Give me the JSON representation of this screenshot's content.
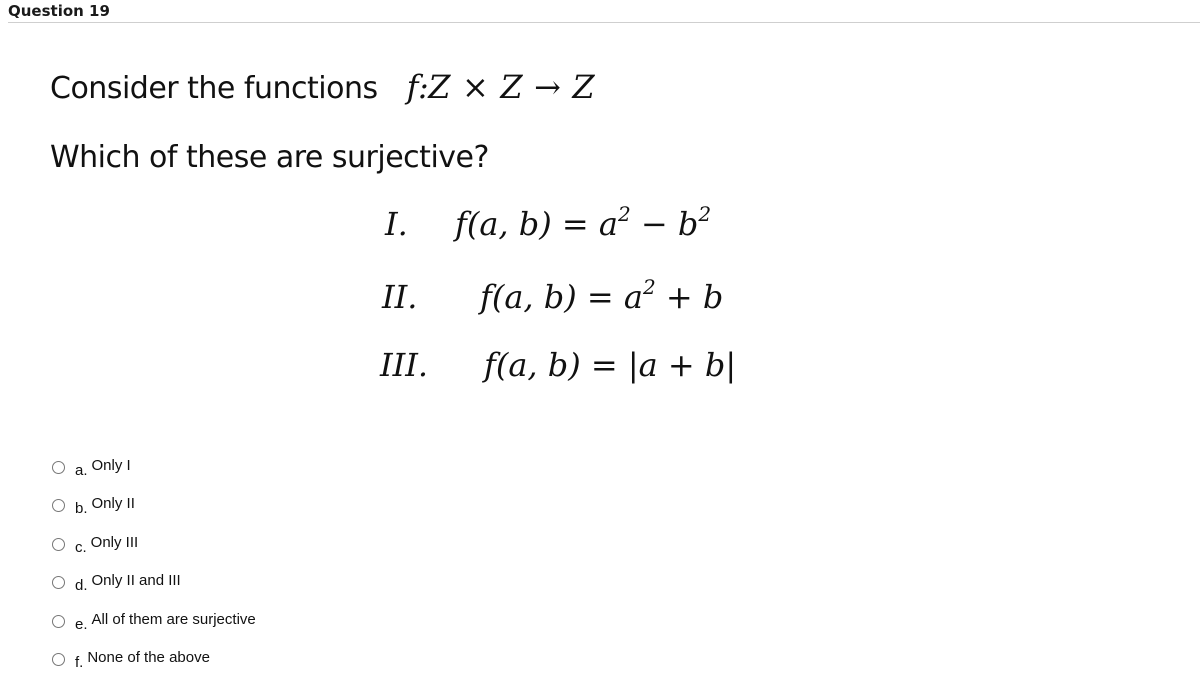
{
  "question": {
    "title": "Question 19",
    "prompt_line1": "Consider the functions",
    "signature": {
      "f": "f",
      "colon": ":",
      "Z1": "Z",
      "times": "×",
      "Z2": "Z",
      "arrow": "→",
      "Z3": "Z"
    },
    "prompt_line2": "Which of these are surjective?"
  },
  "equations": [
    {
      "numeral": "I.",
      "lhs": "f(a, b) = a",
      "exp1": "2",
      "mid": " − b",
      "exp2": "2",
      "tail": ""
    },
    {
      "numeral": "II.",
      "lhs": "f(a, b) = a",
      "exp1": "2",
      "mid": " + b",
      "exp2": "",
      "tail": ""
    },
    {
      "numeral": "III.",
      "lhs": "f(a, b) = |a + b|",
      "exp1": "",
      "mid": "",
      "exp2": "",
      "tail": ""
    }
  ],
  "options": [
    {
      "letter": "a.",
      "text": "Only I",
      "selected": false
    },
    {
      "letter": "b.",
      "text": "Only II",
      "selected": false
    },
    {
      "letter": "c.",
      "text": "Only III",
      "selected": false
    },
    {
      "letter": "d.",
      "text": "Only II and III",
      "selected": false
    },
    {
      "letter": "e.",
      "text": "All of them are surjective",
      "selected": false
    },
    {
      "letter": "f.",
      "text": "None of the above",
      "selected": false
    }
  ]
}
